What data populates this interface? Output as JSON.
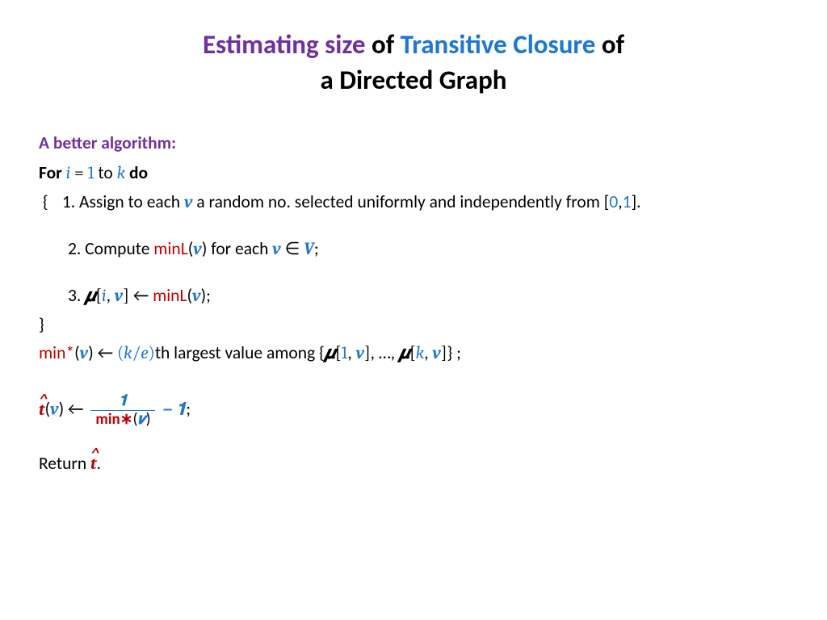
{
  "title": {
    "t1": "Estimating size",
    "t2": " of ",
    "t3": "Transitive Closure",
    "t4": " of",
    "t5": "a Directed Graph"
  },
  "subhead": "A better algorithm:",
  "forline": {
    "for": "For ",
    "i": "i",
    "eq": " = ",
    "one": "1",
    "to": " to ",
    "k": "k",
    "do": " do"
  },
  "brace": "{",
  "step1": {
    "pre": "1. Assign to each ",
    "v": "v",
    "mid": " a random no. selected uniformly and independently from [",
    "zero": "0",
    "comma": ",",
    "one": "1",
    "post": "]."
  },
  "step2": {
    "pre": "2. Compute ",
    "minL": "minL",
    "lp": "(",
    "v": "v",
    "rp": ")",
    "mid": " for each ",
    "v2": "v",
    "in": " ∈ ",
    "V": "V",
    "semi": ";"
  },
  "step3": {
    "pre": "3. ",
    "mu": "𝝁",
    "lb": "[",
    "i": "i",
    "c1": ", ",
    "v": "v",
    "rb": "]",
    "arrow": "  ←  ",
    "minL": "minL",
    "lp": "(",
    "v2": "v",
    "rp": ");"
  },
  "closebrace": "}",
  "minstar": {
    "label": "min*",
    "lp": "(",
    "v": "v",
    "rp": ")",
    "arrow": "  ←  ",
    "ke_l": "(",
    "k": "k",
    "slash": "/",
    "e": "e",
    "ke_r": ")",
    "mid": "th largest value among {",
    "mu1": "𝝁",
    "lb1": "[",
    "one": "1",
    "c1": ", ",
    "v1": "v",
    "rb1": "]",
    "dots": ", …, ",
    "mu2": "𝝁",
    "lb2": "[",
    "k2": "k",
    "c2": ", ",
    "v2": "v",
    "rb2": "]",
    "end": "} ;"
  },
  "that_line": {
    "t": "t",
    "lp": "(",
    "v": "v",
    "rp": ")",
    "arrow": "  ←  ",
    "num": "𝟏",
    "den_min": "min∗",
    "den_lp": "(",
    "den_v": "𝒗",
    "den_rp": ")",
    "minus": " − ",
    "one": "𝟏",
    "semi": ";"
  },
  "return_line": {
    "ret": "Return  ",
    "t": "t",
    "dot": "."
  }
}
